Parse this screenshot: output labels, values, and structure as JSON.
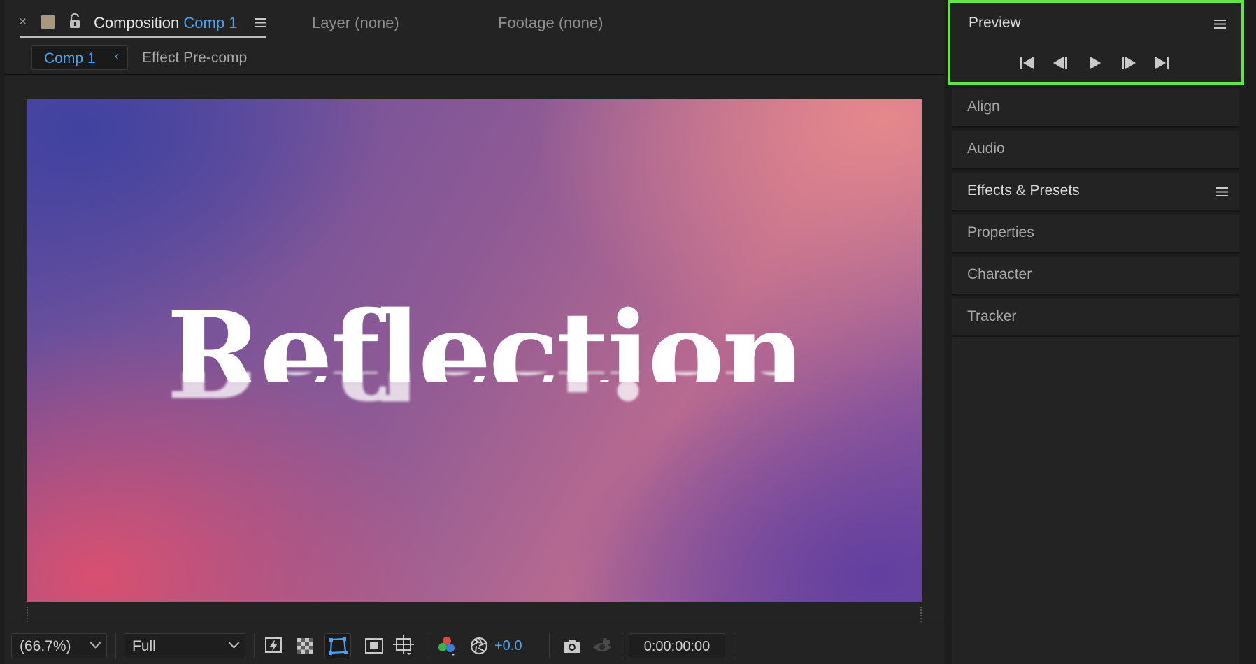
{
  "composition_panel": {
    "tabs": {
      "close_label": "×",
      "active_prefix": "Composition",
      "active_name": "Comp 1",
      "layer": "Layer (none)",
      "footage": "Footage (none)"
    },
    "breadcrumbs": {
      "current": "Comp 1",
      "chevron": "‹",
      "next": "Effect Pre-comp"
    },
    "canvas": {
      "title_text": "Reflection",
      "colors": {
        "top_left": "#40429f",
        "top_right": "#e88a8c",
        "bottom_left": "#de506e",
        "bottom_right": "#603ea0",
        "text": "#ffffff"
      }
    },
    "bottom_bar": {
      "zoom": "(66.7%)",
      "resolution": "Full",
      "exposure": "+0.0",
      "timecode": "0:00:00:00",
      "icons": [
        "fast-previews-icon",
        "transparency-grid-icon",
        "mask-path-visibility-icon",
        "region-of-interest-icon",
        "grid-guides-icon",
        "channel-icon",
        "reset-exposure-icon",
        "snapshot-camera-icon",
        "show-snapshot-icon"
      ]
    }
  },
  "right_panels": {
    "preview": {
      "title": "Preview",
      "controls": [
        "first-frame-icon",
        "previous-frame-icon",
        "play-icon",
        "next-frame-icon",
        "last-frame-icon"
      ],
      "highlight_color": "#68e24b"
    },
    "collapsed": [
      {
        "title": "Align"
      },
      {
        "title": "Audio"
      },
      {
        "title": "Effects & Presets"
      },
      {
        "title": "Properties"
      },
      {
        "title": "Character"
      },
      {
        "title": "Tracker"
      }
    ]
  },
  "accent_color": "#4aa3f0"
}
